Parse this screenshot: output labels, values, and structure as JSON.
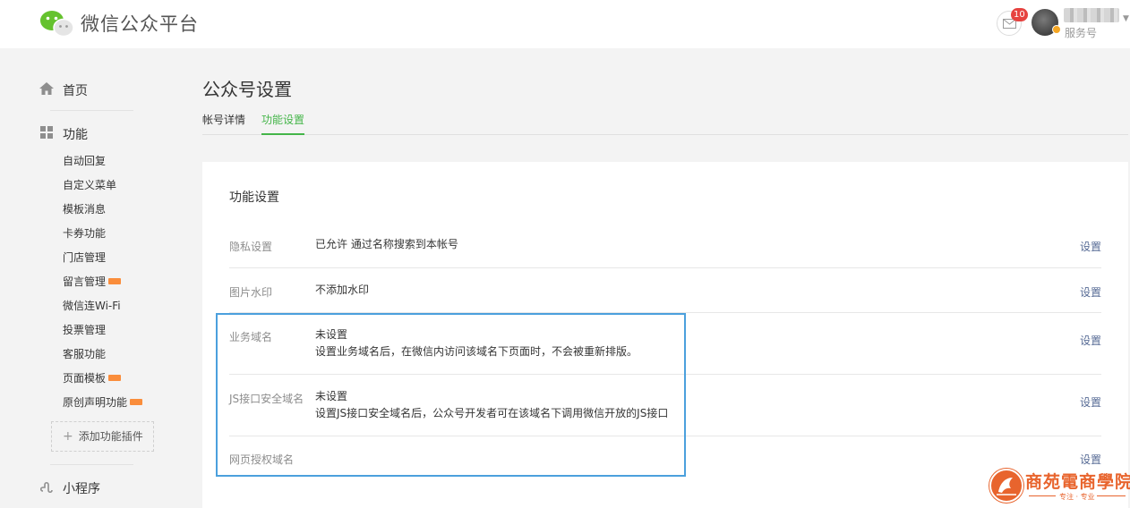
{
  "header": {
    "brand": "微信公众平台",
    "notification_count": "10",
    "account_type": "服务号"
  },
  "sidebar": {
    "home": "首页",
    "function": "功能",
    "items": [
      {
        "label": "自动回复",
        "new": false
      },
      {
        "label": "自定义菜单",
        "new": false
      },
      {
        "label": "模板消息",
        "new": false
      },
      {
        "label": "卡券功能",
        "new": false
      },
      {
        "label": "门店管理",
        "new": false
      },
      {
        "label": "留言管理",
        "new": true
      },
      {
        "label": "微信连Wi-Fi",
        "new": false
      },
      {
        "label": "投票管理",
        "new": false
      },
      {
        "label": "客服功能",
        "new": false
      },
      {
        "label": "页面模板",
        "new": true
      },
      {
        "label": "原创声明功能",
        "new": true
      }
    ],
    "add_plugin": "添加功能插件",
    "mini_program": "小程序"
  },
  "main": {
    "title": "公众号设置",
    "tabs": [
      {
        "label": "帐号详情",
        "active": false
      },
      {
        "label": "功能设置",
        "active": true
      }
    ],
    "card_title": "功能设置",
    "rows": [
      {
        "label": "隐私设置",
        "value": "已允许 通过名称搜索到本帐号",
        "desc": "",
        "action": "设置"
      },
      {
        "label": "图片水印",
        "value": "不添加水印",
        "desc": "",
        "action": "设置"
      },
      {
        "label": "业务域名",
        "value": "未设置",
        "desc": "设置业务域名后，在微信内访问该域名下页面时，不会被重新排版。",
        "action": "设置"
      },
      {
        "label": "JS接口安全域名",
        "value": "未设置",
        "desc": "设置JS接口安全域名后，公众号开发者可在该域名下调用微信开放的JS接口",
        "action": "设置"
      },
      {
        "label": "网页授权域名",
        "value": "",
        "desc": "",
        "action": "设置"
      }
    ]
  },
  "watermark": {
    "text": "商苑電商學院",
    "sub": "专注 · 专业"
  },
  "colors": {
    "accent_green": "#44b549",
    "link_blue": "#576b95",
    "highlight_blue": "#4ba0dd",
    "badge_red": "#e64340",
    "watermark_orange": "#e8642d"
  }
}
